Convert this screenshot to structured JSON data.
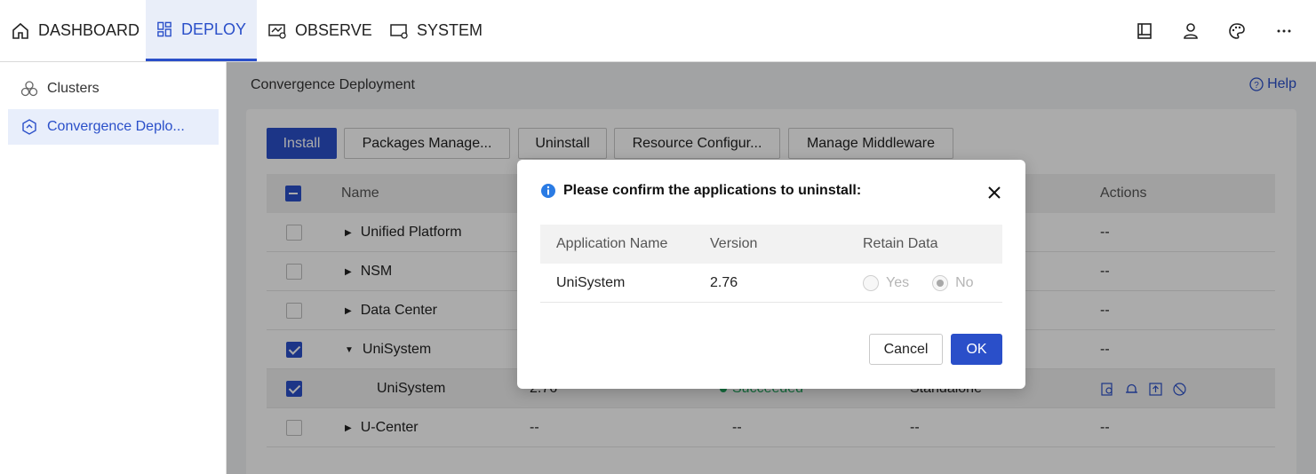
{
  "nav": {
    "items": [
      {
        "label": "DASHBOARD",
        "icon": "home-icon"
      },
      {
        "label": "DEPLOY",
        "icon": "grid-icon"
      },
      {
        "label": "OBSERVE",
        "icon": "monitor-chart-icon"
      },
      {
        "label": "SYSTEM",
        "icon": "monitor-gear-icon"
      }
    ],
    "right_icons": [
      "book-icon",
      "user-icon",
      "palette-icon",
      "more-icon"
    ]
  },
  "sidebar": {
    "items": [
      {
        "label": "Clusters",
        "icon": "clusters-icon"
      },
      {
        "label": "Convergence Deplo...",
        "icon": "deploy-hex-icon"
      }
    ]
  },
  "main": {
    "title": "Convergence Deployment",
    "help_label": "Help",
    "buttons": {
      "install": "Install",
      "packages": "Packages Manage...",
      "uninstall": "Uninstall",
      "resource": "Resource Configur...",
      "middleware": "Manage Middleware"
    },
    "table": {
      "headers": {
        "name": "Name",
        "actions": "Actions"
      },
      "rows": [
        {
          "name": "Unified Platform",
          "version": "",
          "status": "",
          "mode": "",
          "actions": "--"
        },
        {
          "name": "NSM",
          "version": "",
          "status": "",
          "mode": "",
          "actions": "--"
        },
        {
          "name": "Data Center",
          "version": "",
          "status": "",
          "mode": "",
          "actions": "--"
        },
        {
          "name": "UniSystem",
          "version": "",
          "status": "",
          "mode": "",
          "actions": "--"
        },
        {
          "name": "UniSystem",
          "version": "2.76",
          "status": "Succeeded",
          "mode": "Standalone",
          "actions": ""
        },
        {
          "name": "U-Center",
          "version": "--",
          "status": "--",
          "mode": "--",
          "actions": "--"
        }
      ]
    }
  },
  "dialog": {
    "title": "Please confirm the applications to uninstall:",
    "headers": {
      "app_name": "Application Name",
      "version": "Version",
      "retain": "Retain Data"
    },
    "row": {
      "app_name": "UniSystem",
      "version": "2.76",
      "yes": "Yes",
      "no": "No",
      "selected": "No"
    },
    "cancel": "Cancel",
    "ok": "OK"
  },
  "colors": {
    "accent": "#2a4fc9",
    "success": "#1fa05a"
  }
}
